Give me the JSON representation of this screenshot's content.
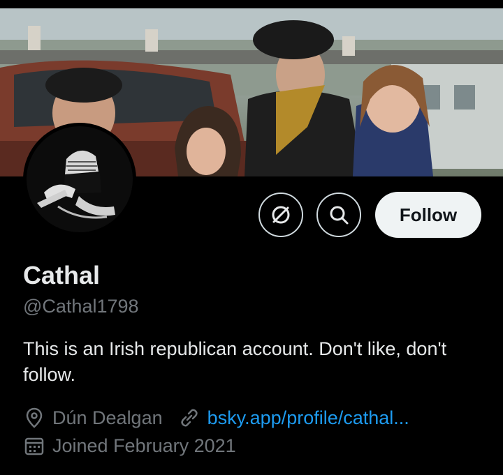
{
  "profile": {
    "display_name": "Cathal",
    "handle": "@Cathal1798",
    "bio": "This is an Irish republican account. Don't like, don't follow.",
    "location": "Dún Dealgan",
    "website": "bsky.app/profile/cathal...",
    "joined": "Joined February 2021"
  },
  "actions": {
    "follow_label": "Follow",
    "block_icon": "block-icon",
    "search_icon": "search-icon"
  },
  "colors": {
    "background": "#000000",
    "text_primary": "#e7e9ea",
    "text_secondary": "#71767b",
    "link": "#1d9bf0",
    "follow_bg": "#eff3f4"
  }
}
